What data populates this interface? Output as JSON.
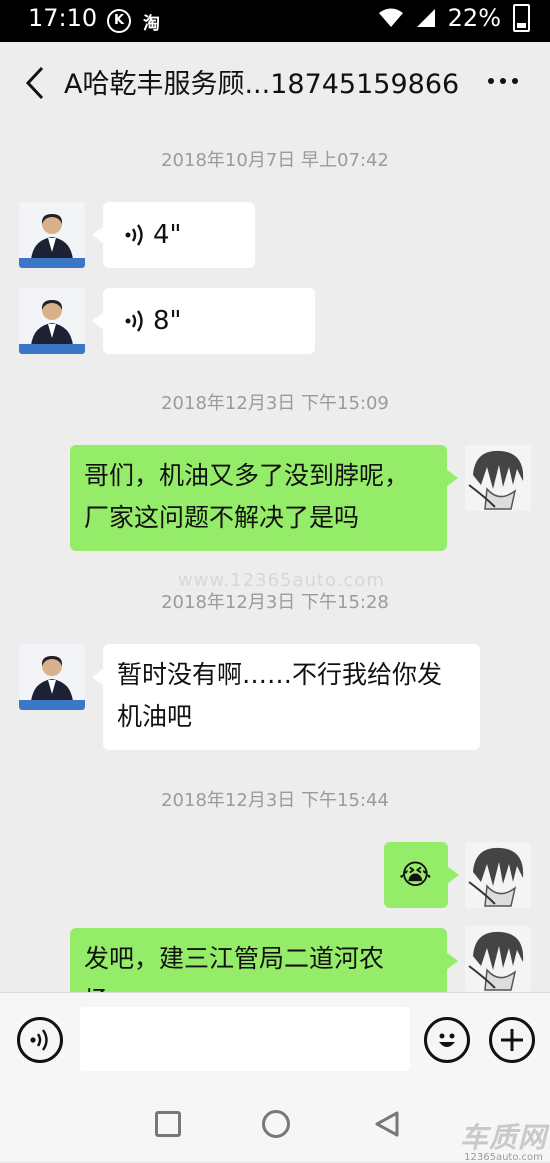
{
  "status_bar": {
    "time": "17:10",
    "k_icon_label": "K",
    "tao_label": "淘",
    "battery": "22%",
    "icons": [
      "k-badge-icon",
      "taobao-icon",
      "wifi-icon",
      "signal-icon",
      "battery-icon"
    ]
  },
  "header": {
    "title": "A哈乾丰服务顾...18745159866",
    "back_icon": "back-arrow-icon",
    "more_icon": "more-dots-icon"
  },
  "messages": [
    {
      "type": "timestamp",
      "text": "2018年10月7日 早上07:42"
    },
    {
      "type": "voice",
      "side": "in",
      "duration": "4\""
    },
    {
      "type": "voice",
      "side": "in",
      "duration": "8\""
    },
    {
      "type": "timestamp",
      "text": "2018年12月3日 下午15:09"
    },
    {
      "type": "text",
      "side": "out",
      "lines": [
        "哥们，机油又多了没到脖呢，",
        "厂家这问题不解决了是吗"
      ]
    },
    {
      "type": "timestamp",
      "text": "2018年12月3日 下午15:28"
    },
    {
      "type": "text",
      "side": "in",
      "lines": [
        "暂时没有啊……不行我给你发",
        "机油吧"
      ]
    },
    {
      "type": "timestamp",
      "text": "2018年12月3日 下午15:44"
    },
    {
      "type": "emoji",
      "side": "out",
      "emoji": "😭"
    },
    {
      "type": "text",
      "side": "out",
      "lines": [
        "发吧，建三江管局二道河农",
        "场"
      ]
    }
  ],
  "watermark": "www.12365auto.com",
  "input_bar": {
    "voice_icon": "voice-input-icon",
    "emoji_icon": "emoji-icon",
    "plus_icon": "plus-icon",
    "text_value": ""
  },
  "brand": {
    "name": "车质网",
    "url": "12365auto.com"
  },
  "colors": {
    "background": "#ededed",
    "outgoing_bubble": "#95ec69",
    "incoming_bubble": "#ffffff"
  }
}
